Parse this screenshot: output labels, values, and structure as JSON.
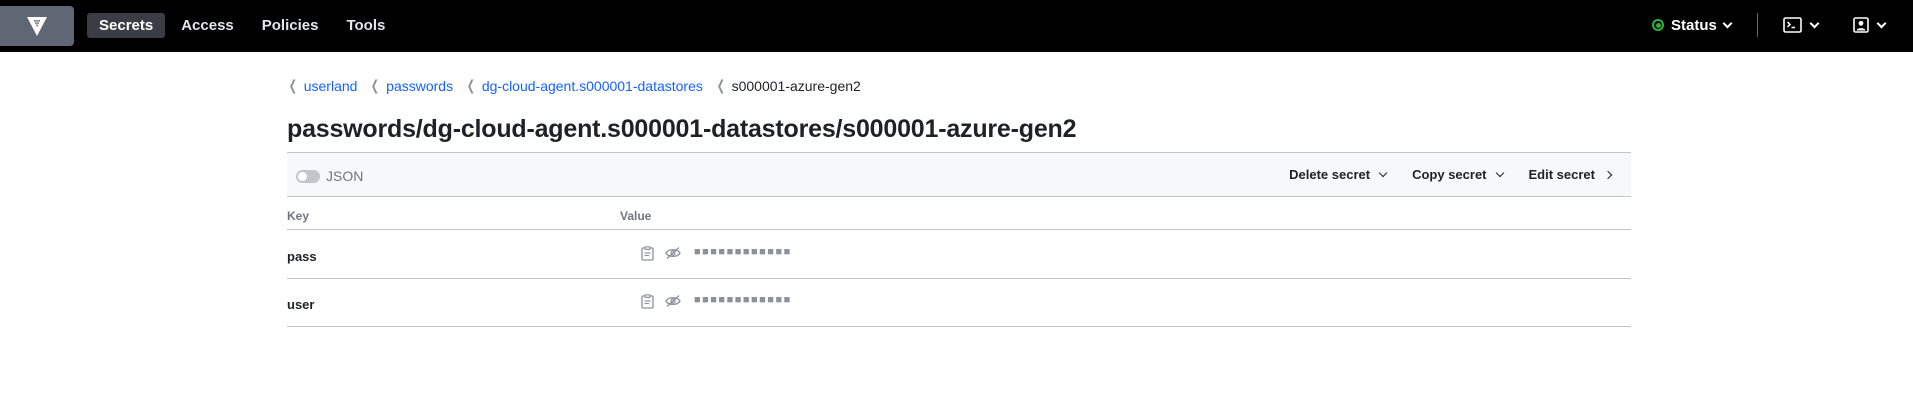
{
  "nav": {
    "logo_icon": "vault-logo-icon",
    "links": [
      {
        "label": "Secrets",
        "active": true
      },
      {
        "label": "Access",
        "active": false
      },
      {
        "label": "Policies",
        "active": false
      },
      {
        "label": "Tools",
        "active": false
      }
    ],
    "status_label": "Status",
    "status_color": "#2eb039"
  },
  "breadcrumb": [
    {
      "label": "userland",
      "link": true
    },
    {
      "label": "passwords",
      "link": true
    },
    {
      "label": "dg-cloud-agent.s000001-datastores",
      "link": true
    },
    {
      "label": "s000001-azure-gen2",
      "link": false
    }
  ],
  "page_title": "passwords/dg-cloud-agent.s000001-datastores/s000001-azure-gen2",
  "toolbar": {
    "json_toggle_label": "JSON",
    "json_toggle_on": false,
    "delete_label": "Delete secret",
    "copy_label": "Copy secret",
    "edit_label": "Edit secret"
  },
  "table": {
    "headers": {
      "key": "Key",
      "value": "Value"
    },
    "rows": [
      {
        "key": "pass",
        "value_masked": "■■■■■■■■■■■■"
      },
      {
        "key": "user",
        "value_masked": "■■■■■■■■■■■■"
      }
    ]
  },
  "colors": {
    "nav_bg": "#000000",
    "link": "#1563ff",
    "border": "#c2c5cb"
  }
}
